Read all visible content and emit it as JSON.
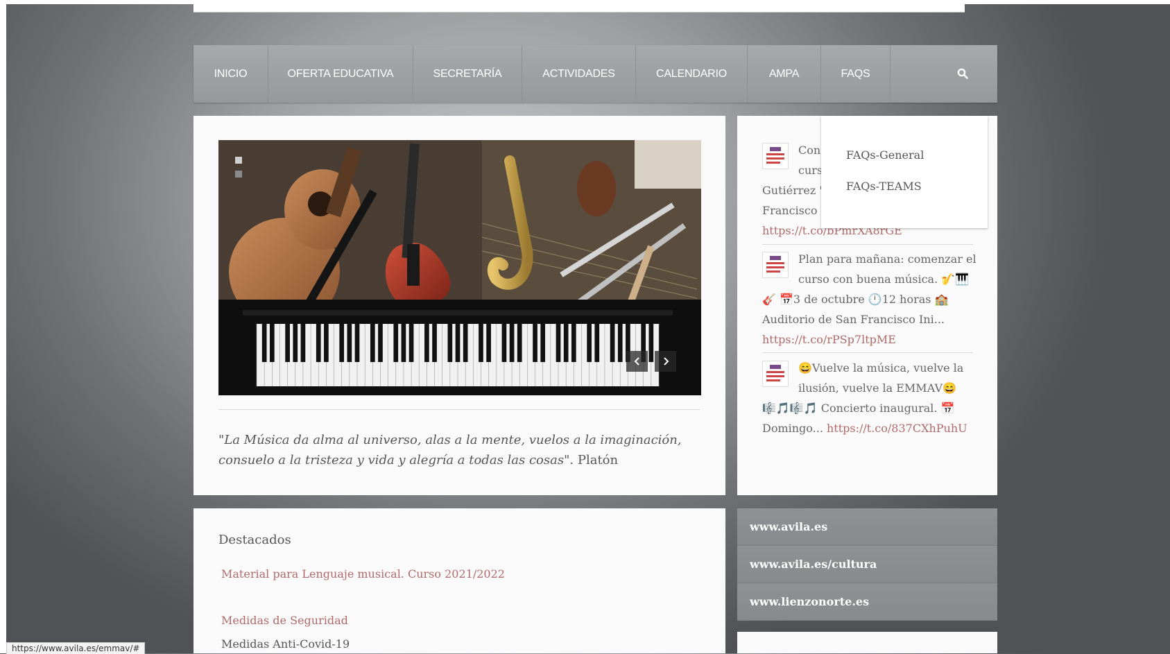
{
  "nav": {
    "items": [
      {
        "label": "INICIO"
      },
      {
        "label": "OFERTA EDUCATIVA"
      },
      {
        "label": "SECRETARÍA"
      },
      {
        "label": "ACTIVIDADES"
      },
      {
        "label": "CALENDARIO"
      },
      {
        "label": "AMPA"
      },
      {
        "label": "FAQS"
      }
    ],
    "search_icon": "search-icon"
  },
  "dropdown": {
    "items": [
      {
        "label": "FAQs-General"
      },
      {
        "label": "FAQs-TEAMS"
      }
    ]
  },
  "quote": {
    "text": "\"La Música da alma al universo, alas a la mente, vuelos a la imaginación, consuelo a la tristeza y vida y alegría a todas las cosas\".",
    "author": "Platón"
  },
  "tweets": [
    {
      "line1": "Con",
      "line2": "curs",
      "line3": "Gutiérrez \"",
      "line4": "Francisco I",
      "link": "https://t.co/bPmrXA8rGE"
    },
    {
      "text_a": "Plan para mañana: comenzar el curso con buena música. 🎷🎹",
      "text_b": "🎸 📅3 de octubre 🕛12 horas 🏫",
      "text_c": "Auditorio de San Francisco Ini...",
      "link": "https://t.co/rPSp7ltpME"
    },
    {
      "text_a": "😄Vuelve la música, vuelve la ilusión, vuelve la EMMAV😄",
      "text_b": "🎼🎵🎼🎵 Concierto inaugural. 📅",
      "text_c": "Domingo...",
      "link": "https://t.co/837CXhPuhU"
    }
  ],
  "links": [
    {
      "label": "www.avila.es"
    },
    {
      "label": "www.avila.es/cultura"
    },
    {
      "label": "www.lienzonorte.es"
    }
  ],
  "featured": {
    "title": "Destacados",
    "link1": "Material para Lenguaje musical. Curso 2021/2022",
    "link2": "Medidas de Seguridad",
    "text": "Medidas Anti-Covid-19"
  },
  "status_bar": {
    "url": "https://www.avila.es/emmav/#"
  }
}
